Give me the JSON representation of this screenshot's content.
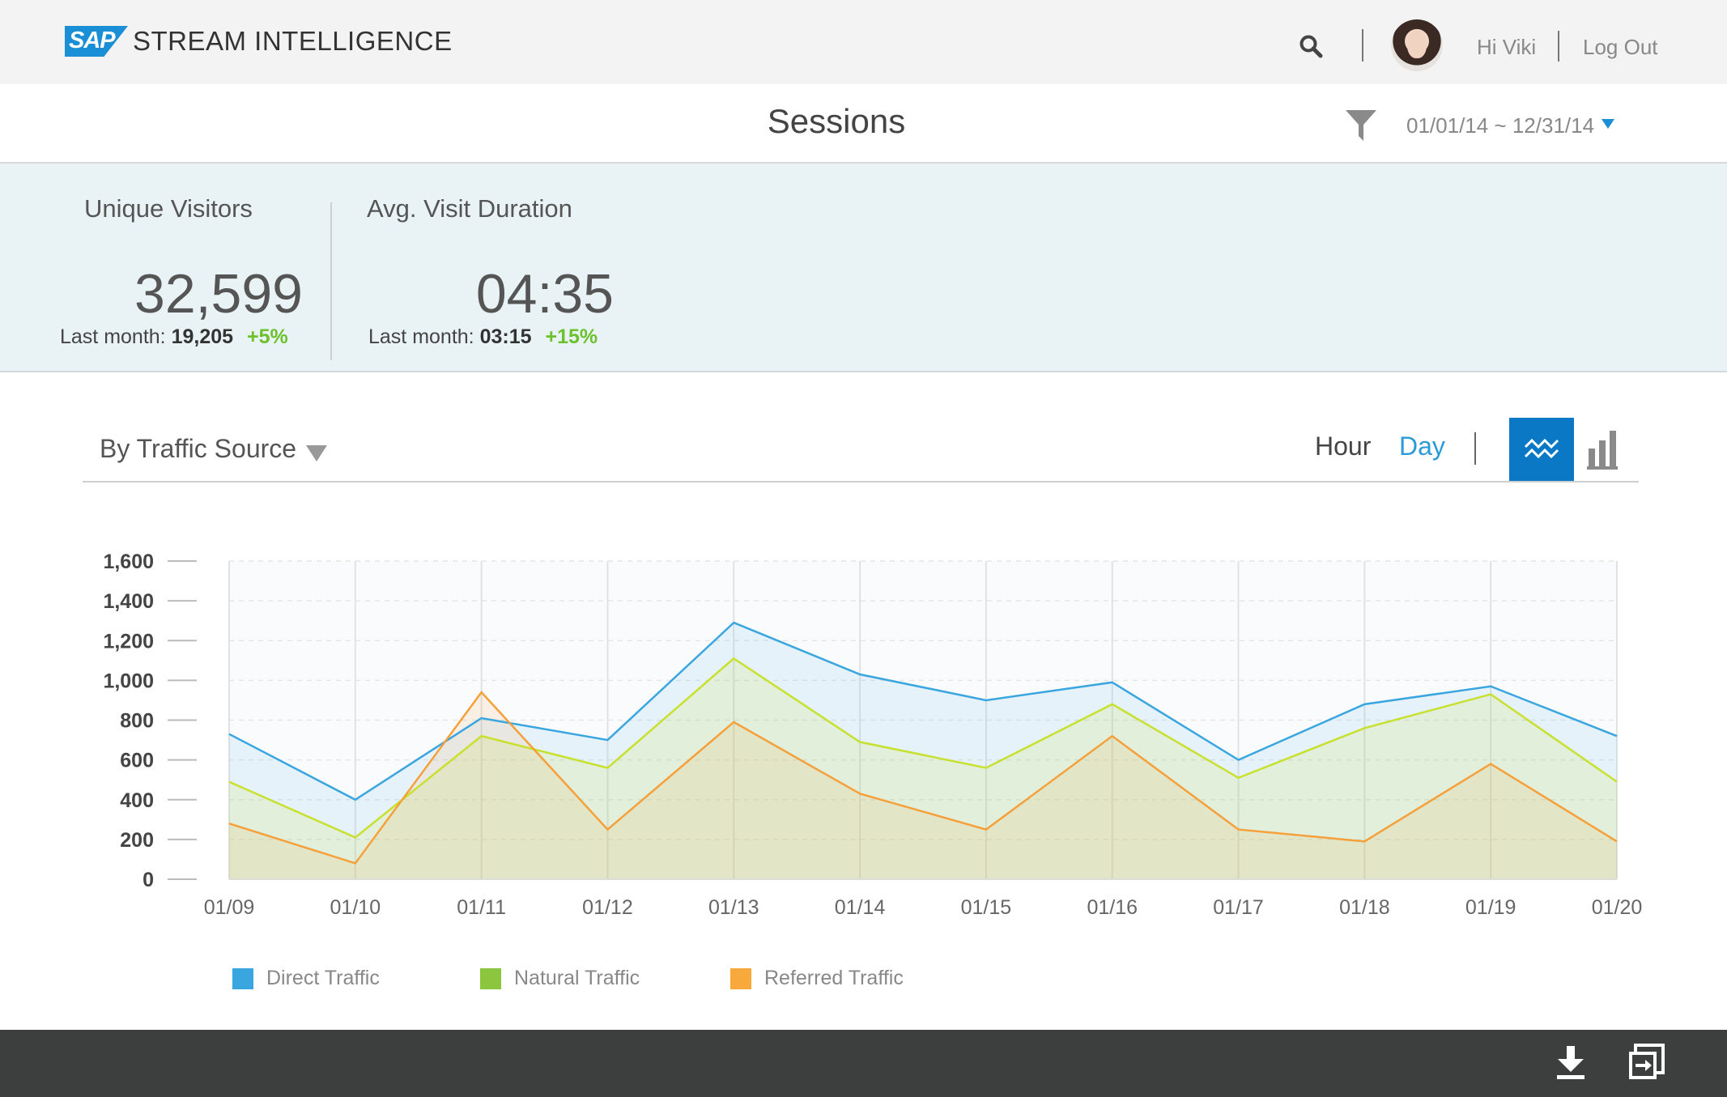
{
  "header": {
    "brand_badge": "SAP",
    "app_title": "STREAM INTELLIGENCE",
    "greeting": "Hi Viki",
    "logout_label": "Log Out"
  },
  "page": {
    "title": "Sessions",
    "date_range": "01/01/14 ~ 12/31/14"
  },
  "kpis": [
    {
      "label": "Unique Visitors",
      "value": "32,599",
      "last_month_label": "Last month:",
      "last_month_value": "19,205",
      "change": "+5%"
    },
    {
      "label": "Avg. Visit Duration",
      "value": "04:35",
      "last_month_label": "Last month:",
      "last_month_value": "03:15",
      "change": "+15%"
    }
  ],
  "chart_toolbar": {
    "group_by": "By Traffic Source",
    "granularity": [
      "Hour",
      "Day"
    ],
    "selected_granularity": "Day",
    "selected_view": "line"
  },
  "colors": {
    "accent": "#1a8fd6",
    "positive": "#6cc12c",
    "direct": "#3aa6e0",
    "natural": "#c8e02e",
    "referred": "#f5a03a"
  },
  "chart_data": {
    "type": "area",
    "x": [
      "01/09",
      "01/10",
      "01/11",
      "01/12",
      "01/13",
      "01/14",
      "01/15",
      "01/16",
      "01/17",
      "01/18",
      "01/19",
      "01/20"
    ],
    "ylim": [
      0,
      1600
    ],
    "yticks": [
      "1,600",
      "1,400",
      "1,200",
      "1,000",
      "800",
      "600",
      "400",
      "200",
      "0"
    ],
    "ytick_values": [
      1600,
      1400,
      1200,
      1000,
      800,
      600,
      400,
      200,
      0
    ],
    "grid": true,
    "legend_position": "bottom-left",
    "series": [
      {
        "name": "Direct Traffic",
        "color": "#3aa6e0",
        "values": [
          730,
          400,
          810,
          700,
          1290,
          1030,
          900,
          990,
          600,
          880,
          970,
          720
        ]
      },
      {
        "name": "Natural Traffic",
        "color": "#c8e02e",
        "values": [
          490,
          210,
          720,
          560,
          1110,
          690,
          560,
          880,
          510,
          760,
          930,
          490
        ]
      },
      {
        "name": "Referred Traffic",
        "color": "#f5a03a",
        "values": [
          280,
          80,
          940,
          250,
          790,
          430,
          250,
          720,
          250,
          190,
          580,
          190
        ]
      }
    ]
  }
}
